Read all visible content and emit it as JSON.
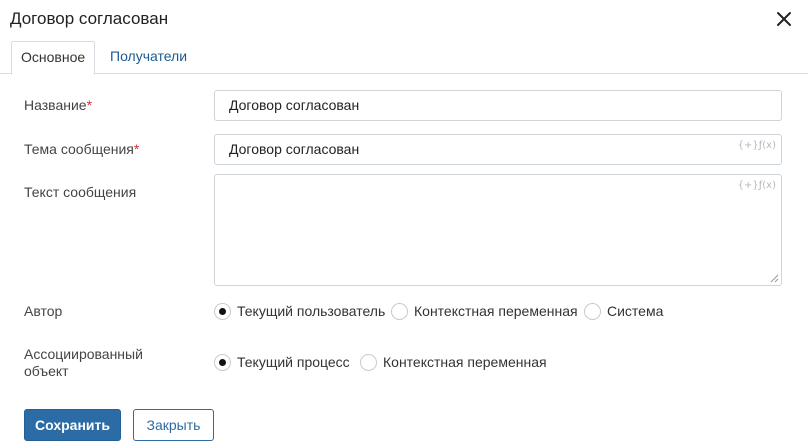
{
  "dialog": {
    "title": "Договор согласован",
    "close_icon": "close-icon"
  },
  "tabs": [
    {
      "label": "Основное",
      "active": true
    },
    {
      "label": "Получатели",
      "active": false
    }
  ],
  "form": {
    "name": {
      "label": "Название",
      "required_mark": "*",
      "value": "Договор согласован"
    },
    "subject": {
      "label": "Тема сообщения",
      "required_mark": "*",
      "value": "Договор согласован",
      "fx_hint": "{+}ƒ(x)"
    },
    "body": {
      "label": "Текст сообщения",
      "value": "",
      "fx_hint": "{+}ƒ(x)"
    },
    "author": {
      "label": "Автор",
      "options": [
        {
          "label": "Текущий пользователь",
          "checked": true
        },
        {
          "label": "Контекстная переменная",
          "checked": false
        },
        {
          "label": "Система",
          "checked": false
        }
      ]
    },
    "associated_object": {
      "label": "Ассоциированный объект",
      "options": [
        {
          "label": "Текущий процесс",
          "checked": true
        },
        {
          "label": "Контекстная переменная",
          "checked": false
        }
      ]
    }
  },
  "buttons": {
    "save": "Сохранить",
    "close": "Закрыть"
  },
  "colors": {
    "primary": "#2c6ca6",
    "link": "#1c5b92",
    "required": "#d0303a",
    "border": "#cfd4da"
  }
}
